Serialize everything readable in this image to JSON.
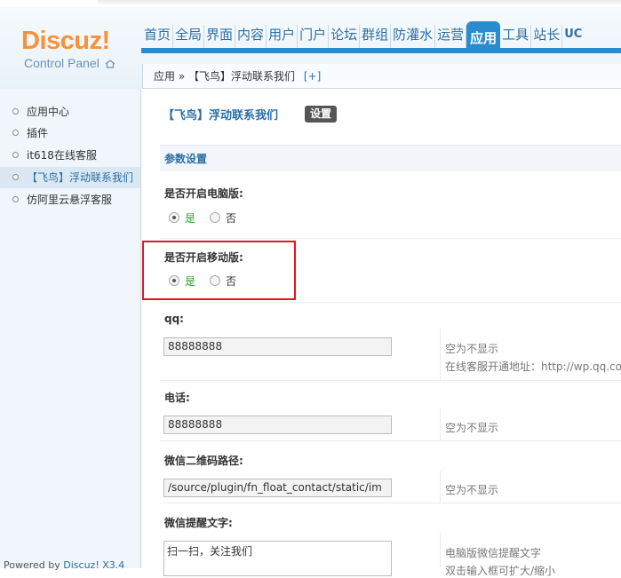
{
  "logo": {
    "brand": "Discuz!",
    "sub": "Control Panel"
  },
  "nav": [
    "首页",
    "全局",
    "界面",
    "内容",
    "用户",
    "门户",
    "论坛",
    "群组",
    "防灌水",
    "运营",
    "应用",
    "工具",
    "站长",
    "UC"
  ],
  "nav_active": "应用",
  "breadcrumb": {
    "root": "应用",
    "sep": "»",
    "current": "【飞鸟】浮动联系我们",
    "add": "[+]"
  },
  "sidebar": {
    "items": [
      "应用中心",
      "插件",
      "it618在线客服",
      "【飞鸟】浮动联系我们",
      "仿阿里云悬浮客服"
    ],
    "active_index": 3,
    "powered": "Powered by ",
    "powered_link": "Discuz! X3.4"
  },
  "page": {
    "title": "【飞鸟】浮动联系我们",
    "settings_button": "设置",
    "section": "参数设置"
  },
  "fields": {
    "pc_label": "是否开启电脑版:",
    "mobile_label": "是否开启移动版:",
    "yes": "是",
    "no": "否",
    "qq_label": "qq:",
    "qq_value": "88888888",
    "qq_hint1": "空为不显示",
    "qq_hint2": "在线客服开通地址：http://wp.qq.co",
    "phone_label": "电话:",
    "phone_value": "88888888",
    "phone_hint": "空为不显示",
    "wechat_qr_label": "微信二维码路径:",
    "wechat_qr_value": "/source/plugin/fn_float_contact/static/im",
    "wechat_qr_hint": "空为不显示",
    "wechat_tip_label": "微信提醒文字:",
    "wechat_tip_value": "扫一扫，关注我们",
    "wechat_tip_hint1": "电脑版微信提醒文字",
    "wechat_tip_hint2": "双击输入框可扩大/缩小"
  },
  "colors": {
    "accent": "#2a8ccf",
    "logo": "#f7923a",
    "highlight": "#e8141a",
    "yes": "#2aa02a"
  }
}
